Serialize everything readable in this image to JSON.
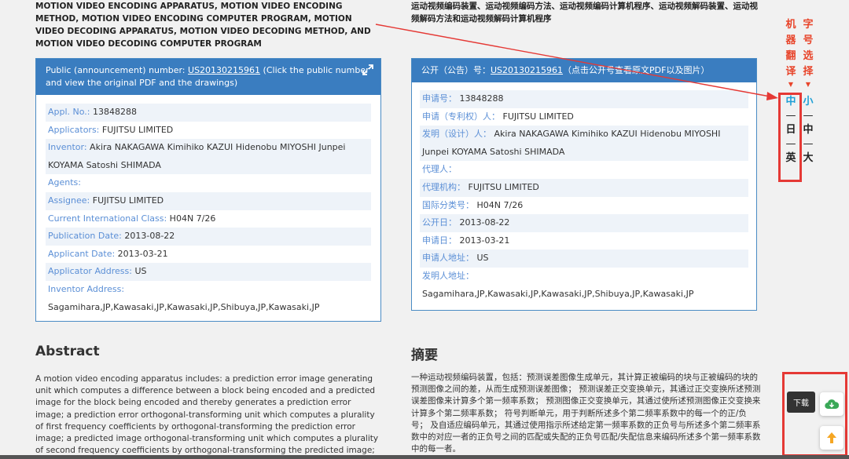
{
  "title_en": "MOTION VIDEO ENCODING APPARATUS, MOTION VIDEO ENCODING METHOD, MOTION VIDEO ENCODING COMPUTER PROGRAM, MOTION VIDEO DECODING APPARATUS, MOTION VIDEO DECODING METHOD, AND MOTION VIDEO DECODING COMPUTER PROGRAM",
  "title_cn": "运动视频编码装置、运动视频编码方法、运动视频编码计算机程序、运动视频解码装置、运动视频解码方法和运动视频解码计算机程序",
  "card_en": {
    "head_prefix": "Public (announcement) number: ",
    "pub_number": "US20130215961",
    "head_suffix": "  (Click the public number and view the original PDF and the drawings)",
    "fields": [
      {
        "label": "Appl. No.:",
        "value": "13848288"
      },
      {
        "label": "Applicators:",
        "value": "FUJITSU LIMITED"
      },
      {
        "label": "Inventor:",
        "value": "Akira NAKAGAWA   Kimihiko KAZUI   Hidenobu MIYOSHI   Junpei KOYAMA   Satoshi SHIMADA"
      },
      {
        "label": "Agents:",
        "value": ""
      },
      {
        "label": "Assignee:",
        "value": "FUJITSU LIMITED"
      },
      {
        "label": "Current International Class:",
        "value": "H04N 7/26"
      },
      {
        "label": "Publication Date:",
        "value": "2013-08-22"
      },
      {
        "label": "Applicant Date:",
        "value": "2013-03-21"
      },
      {
        "label": "Applicator Address:",
        "value": "US"
      },
      {
        "label": "Inventor Address:",
        "value": "Sagamihara,JP,Kawasaki,JP,Kawasaki,JP,Shibuya,JP,Kawasaki,JP"
      }
    ]
  },
  "card_cn": {
    "head_prefix": "公开（公告）号：",
    "pub_number": "US20130215961",
    "head_suffix": "（点击公开号查看原文PDF以及图片）",
    "fields": [
      {
        "label": "申请号：",
        "value": "13848288"
      },
      {
        "label": "申请（专利权）人：",
        "value": "FUJITSU LIMITED"
      },
      {
        "label": "发明（设计）人：",
        "value": "Akira NAKAGAWA   Kimihiko KAZUI   Hidenobu MIYOSHI   Junpei KOYAMA   Satoshi SHIMADA"
      },
      {
        "label": "代理人：",
        "value": ""
      },
      {
        "label": "代理机构：",
        "value": "FUJITSU LIMITED"
      },
      {
        "label": "国际分类号：",
        "value": "H04N 7/26"
      },
      {
        "label": "公开日：",
        "value": "2013-08-22"
      },
      {
        "label": "申请日：",
        "value": "2013-03-21"
      },
      {
        "label": "申请人地址：",
        "value": "US"
      },
      {
        "label": "发明人地址：",
        "value": "Sagamihara,JP,Kawasaki,JP,Kawasaki,JP,Shibuya,JP,Kawasaki,JP"
      }
    ]
  },
  "abstract_en_title": "Abstract",
  "abstract_en": "A motion video encoding apparatus includes: a prediction error image generating unit which computes a difference between a block being encoded and a predicted image for the block being encoded and thereby generates a prediction error image; a prediction error orthogonal-transforming unit which computes a plurality of first frequency coefficients by orthogonal-transforming the prediction error image; a predicted image orthogonal-transforming unit which computes a plurality of second frequency coefficients by orthogonal-transforming the predicted image; a sign judging unit which judges the positive/negative sign",
  "abstract_cn_title": "摘要",
  "abstract_cn": "一种运动视频编码装置，包括：预测误差图像生成单元，其计算正被编码的块与正被编码的块的预测图像之间的差，从而生成预测误差图像； 预测误差正交变换单元，其通过正交变换所述预测误差图像来计算多个第一频率系数； 预测图像正交变换单元，其通过使所述预测图像正交变换来计算多个第二频率系数； 符号判断单元，用于判断所述多个第二频率系数中的每一个的正/负号； 及自适应编码单元，其通过使用指示所述给定第一频率系数的正负号与所述多个第二频率系数中的对应一者的正负号之间的匹配或失配的正负号匹配/失配信息来编码所述多个第一频率系数中的每一者。",
  "side_translate": {
    "label_chars": [
      "机",
      "器",
      "翻",
      "译"
    ],
    "options": [
      "中",
      "日",
      "英"
    ]
  },
  "side_fontsize": {
    "label_chars": [
      "字",
      "号",
      "选",
      "择"
    ],
    "options": [
      "小",
      "中",
      "大"
    ]
  },
  "download_tooltip": "下载",
  "colors": {
    "accent": "#3a7dc0",
    "label": "#5b8fd6",
    "annot_red": "#e53935",
    "active": "#1e9fd6"
  },
  "icons": {
    "expand": "expand-icon",
    "download": "cloud-download-icon",
    "top": "arrow-up-icon"
  }
}
